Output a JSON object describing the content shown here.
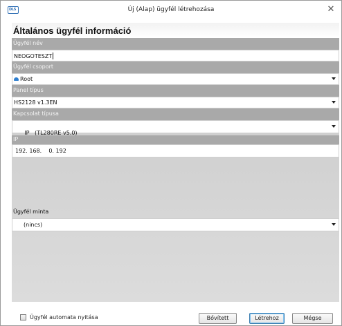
{
  "window": {
    "title": "Új (Alap) ügyfél létrehozása",
    "logo_text": "DLS",
    "close_glyph": "✕"
  },
  "section": {
    "title": "Általános ügyfél információ"
  },
  "fields": {
    "customer_name": {
      "label": "Ügyfél név",
      "value": "NEOGOTESZT"
    },
    "customer_group": {
      "label": "Ügyfél csoport",
      "value": "Root",
      "icon": "folder-icon"
    },
    "panel_type": {
      "label": "Panel típus",
      "value": "HS2128 v1.3EN"
    },
    "connection_type": {
      "label": "Kapcsolat típusa",
      "value": "IP   (TL280RE v5.0)"
    },
    "ip": {
      "label": "IP",
      "value": "192. 168.    0. 192"
    },
    "customer_template": {
      "label": "Ügyfél minta",
      "value": "(nincs)"
    }
  },
  "footer": {
    "auto_open_label": "Ügyfél automata nyitása",
    "auto_open_checked": false,
    "expand_label": "Bővített",
    "create_label": "Létrehoz",
    "cancel_label": "Mégse"
  },
  "colors": {
    "label_band": "#a9a9a9",
    "accent": "#2f7fd0",
    "default_button_border": "#3c7fb1"
  }
}
